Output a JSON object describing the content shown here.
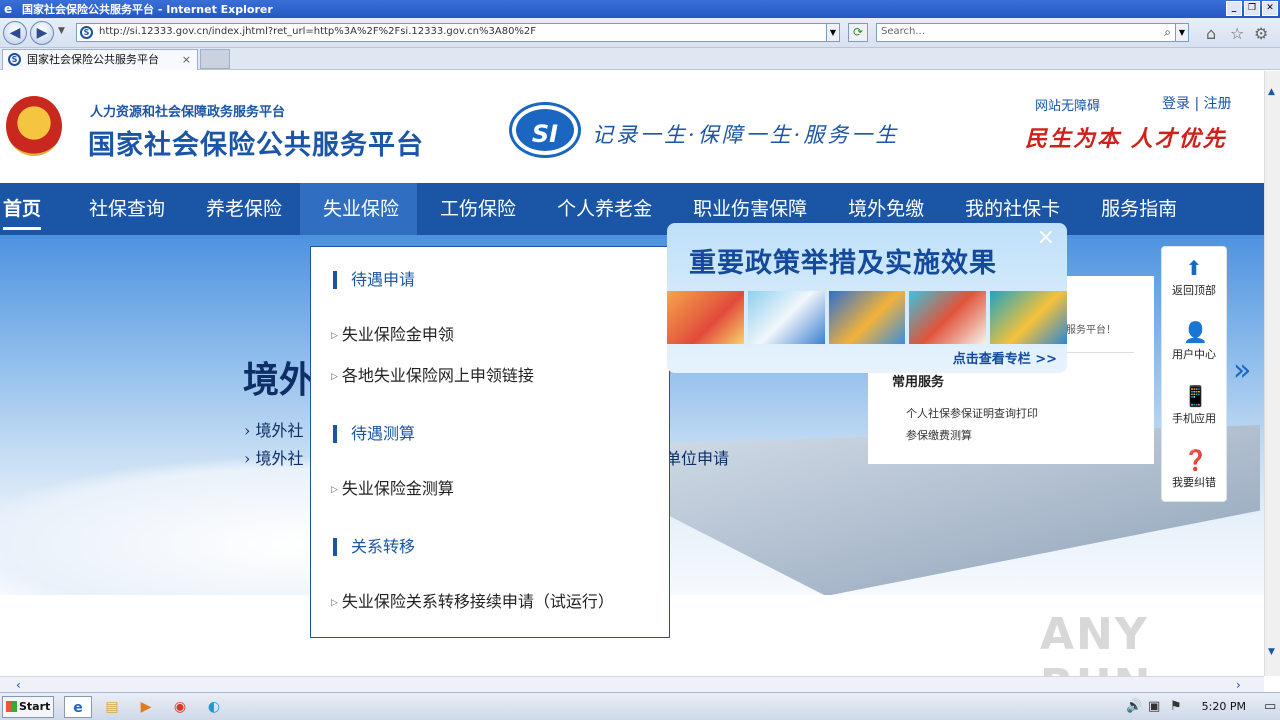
{
  "window": {
    "title": "国家社会保险公共服务平台 - Internet Explorer",
    "url": "http://si.12333.gov.cn/index.jhtml?ret_url=http%3A%2F%2Fsi.12333.gov.cn%3A80%2F",
    "search_placeholder": "Search...",
    "tab_label": "国家社会保险公共服务平台"
  },
  "header": {
    "subtitle": "人力资源和社会保障政务服务平台",
    "title": "国家社会保险公共服务平台",
    "logo_text": "SI",
    "slogan": "记录一生·保障一生·服务一生",
    "accessible": "网站无障碍",
    "login": "登录",
    "separator": "|",
    "register": "注册",
    "motto": "民生为本 人才优先"
  },
  "nav": {
    "items": [
      {
        "label": "首页"
      },
      {
        "label": "社保查询"
      },
      {
        "label": "养老保险"
      },
      {
        "label": "失业保险"
      },
      {
        "label": "工伤保险"
      },
      {
        "label": "个人养老金"
      },
      {
        "label": "职业伤害保障"
      },
      {
        "label": "境外免缴"
      },
      {
        "label": "我的社保卡"
      },
      {
        "label": "服务指南"
      }
    ],
    "active_index": 3
  },
  "banner": {
    "heading": "境外",
    "line1": "境外社",
    "line2": "境外社",
    "tail": "单位申请"
  },
  "dropdown": {
    "sections": [
      {
        "title": "待遇申请",
        "items": [
          "失业保险金申领",
          "各地失业保险网上申领链接"
        ]
      },
      {
        "title": "待遇测算",
        "items": [
          "失业保险金测算"
        ]
      },
      {
        "title": "关系转移",
        "items": [
          "失业保险关系转移接续申请（试运行）"
        ]
      }
    ]
  },
  "card": {
    "partial_text": "服务平台！",
    "title": "常用服务",
    "links": [
      "个人社保参保证明查询打印",
      "参保缴费测算"
    ]
  },
  "popup": {
    "title": "重要政策举措及实施效果",
    "link": "点击查看专栏 >>",
    "close": "×"
  },
  "sidebar": {
    "items": [
      {
        "label": "返回顶部",
        "icon": "arrow-up-icon"
      },
      {
        "label": "用户中心",
        "icon": "user-icon"
      },
      {
        "label": "手机应用",
        "icon": "phone-icon"
      },
      {
        "label": "我要纠错",
        "icon": "question-icon"
      }
    ]
  },
  "watermark": "ANY RUN",
  "taskbar": {
    "start": "Start",
    "time": "5:20 PM"
  },
  "colors": {
    "brand_blue": "#1a55a6",
    "motto_red": "#d0201a"
  }
}
